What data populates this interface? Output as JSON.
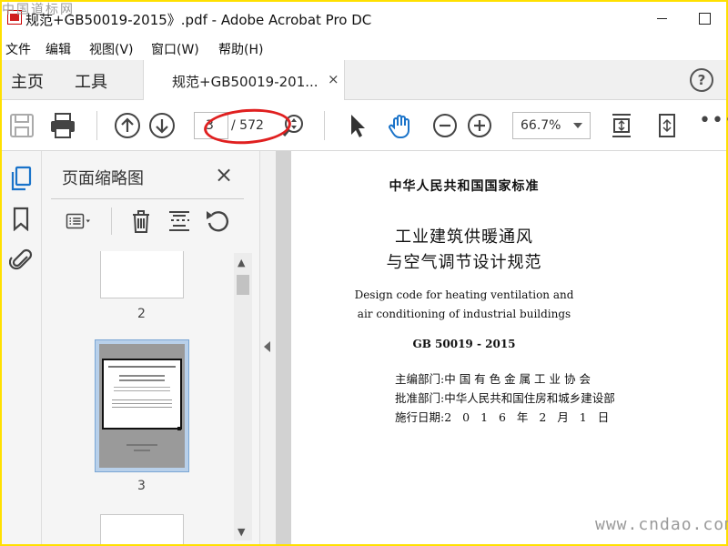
{
  "watermark_top": "中国道标网",
  "watermark_bottom": "www.cndao.com",
  "window": {
    "title": "规范+GB50019-2015》.pdf - Adobe Acrobat Pro DC"
  },
  "menu": [
    "文件",
    "编辑",
    "视图(V)",
    "窗口(W)",
    "帮助(H)"
  ],
  "tabs": {
    "home": "主页",
    "tools": "工具",
    "document": "规范+GB50019-201...",
    "close": "×",
    "help": "?"
  },
  "toolbar": {
    "current_page": "3",
    "page_total": "/ 572",
    "zoom": "66.7%",
    "more": "•••",
    "annotation_color": "#e02020"
  },
  "sidebar": {
    "icons": [
      "pages-icon",
      "bookmark-icon",
      "attachment-icon"
    ]
  },
  "panel": {
    "title": "页面缩略图",
    "close": "×",
    "thumbnails": [
      {
        "label": "2"
      },
      {
        "label": "3",
        "selected": true
      }
    ]
  },
  "document": {
    "standard": "中华人民共和国国家标准",
    "title_line1": "工业建筑供暖通风",
    "title_line2": "与空气调节设计规范",
    "english_line1": "Design code for heating ventilation and",
    "english_line2": "air conditioning of industrial buildings",
    "code": "GB 50019 - 2015",
    "editor_label": "主编部门:",
    "editor_value": "中 国 有 色 金 属 工 业 协 会",
    "approver_label": "批准部门:",
    "approver_value": "中华人民共和国住房和城乡建设部",
    "date_label": "施行日期:",
    "date_value": "2 0 1 6 年 2 月 1 日"
  },
  "colors": {
    "border": "#ffe000",
    "accent_blue": "#1a73c9",
    "annotation": "#e02020"
  }
}
